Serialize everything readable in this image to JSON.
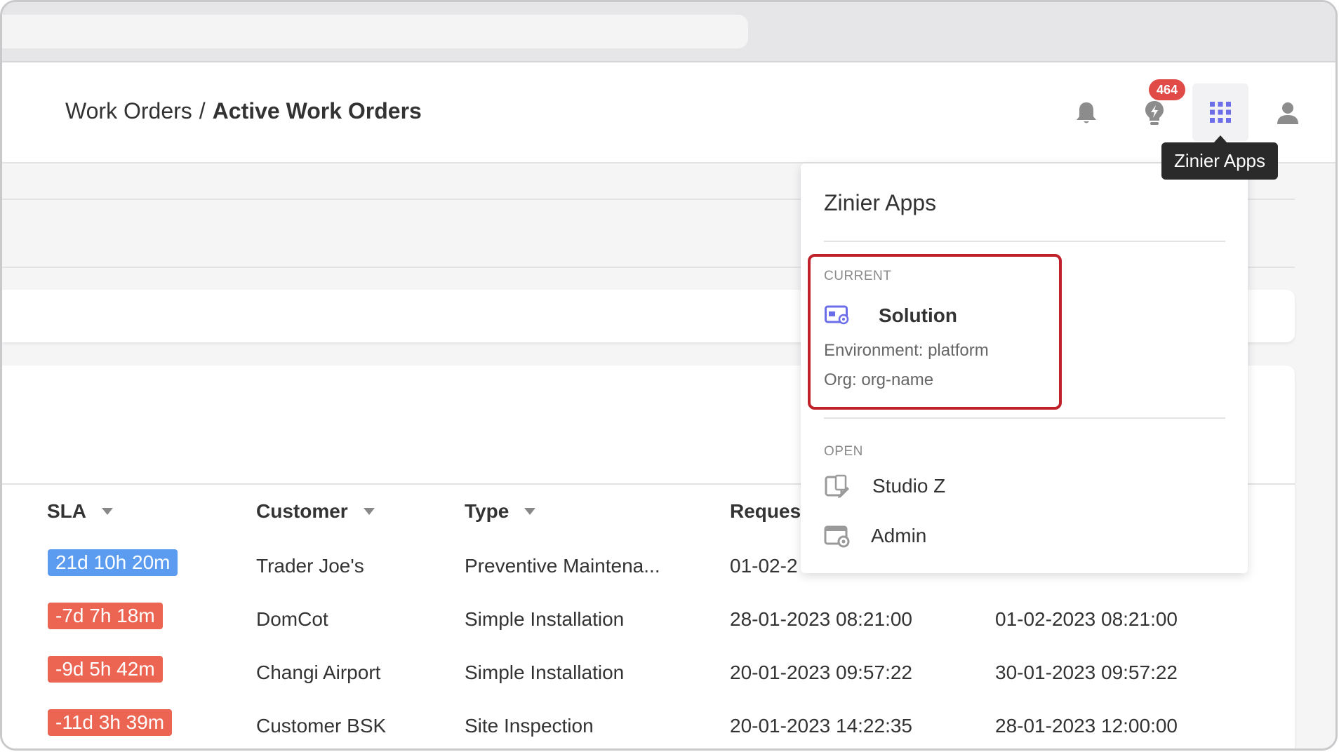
{
  "header": {
    "breadcrumb_parent": "Work Orders",
    "breadcrumb_separator": "/",
    "breadcrumb_current": "Active Work Orders",
    "notifications_badge": "464",
    "apps_tooltip": "Zinier Apps"
  },
  "edge_text": "s",
  "table": {
    "columns": [
      {
        "label": "SLA"
      },
      {
        "label": "Customer"
      },
      {
        "label": "Type"
      },
      {
        "label": "Reques"
      }
    ],
    "rows": [
      {
        "sla": "21d 10h 20m",
        "sla_status": "positive",
        "customer": "Trader Joe's",
        "type": "Preventive Maintena...",
        "requested": "01-02-2",
        "due": ""
      },
      {
        "sla": "-7d 7h 18m",
        "sla_status": "negative",
        "customer": "DomCot",
        "type": "Simple Installation",
        "requested": "28-01-2023 08:21:00",
        "due": "01-02-2023 08:21:00"
      },
      {
        "sla": "-9d 5h 42m",
        "sla_status": "negative",
        "customer": "Changi Airport",
        "type": "Simple Installation",
        "requested": "20-01-2023 09:57:22",
        "due": "30-01-2023 09:57:22"
      },
      {
        "sla": "-11d 3h 39m",
        "sla_status": "negative",
        "customer": "Customer BSK",
        "type": "Site Inspection",
        "requested": "20-01-2023 14:22:35",
        "due": "28-01-2023 12:00:00"
      }
    ]
  },
  "apps_panel": {
    "title": "Zinier Apps",
    "current_label": "CURRENT",
    "current_app": {
      "name": "Solution",
      "icon": "solution-icon",
      "environment": "Environment: platform",
      "org": "Org: org-name"
    },
    "open_label": "OPEN",
    "open_apps": [
      {
        "name": "Studio Z",
        "icon": "studio-z-icon"
      },
      {
        "name": "Admin",
        "icon": "admin-icon"
      }
    ]
  },
  "colors": {
    "accent": "#6b6ee8",
    "badge": "#e14b47",
    "sla_positive": "#5b9cf0",
    "sla_negative": "#ec6452",
    "highlight_box": "#c0202a"
  }
}
